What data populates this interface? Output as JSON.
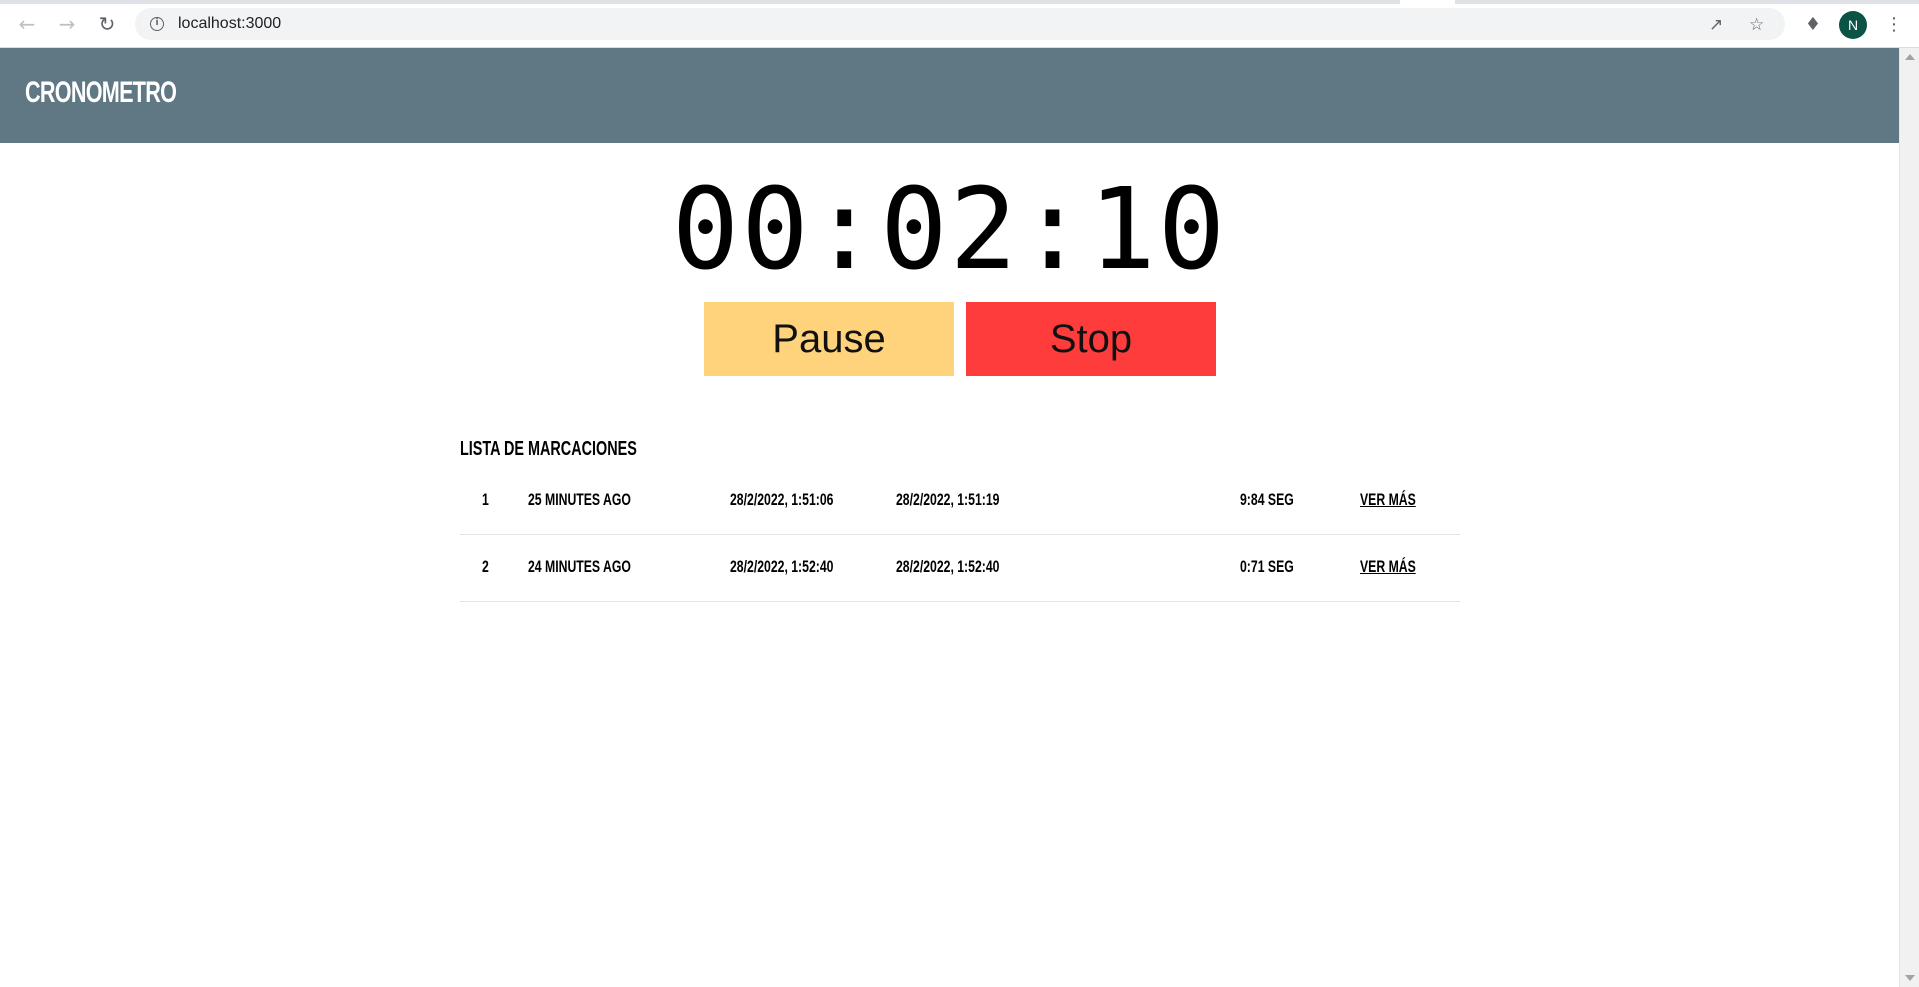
{
  "browser": {
    "url": "localhost:3000",
    "avatar_letter": "N",
    "icons": [
      "back-arrow-icon",
      "forward-arrow-icon",
      "reload-icon",
      "info-icon",
      "share-icon",
      "star-icon",
      "extensions-icon",
      "menu-icon"
    ]
  },
  "app": {
    "title": "CRONOMETRO",
    "header_color": "#607884"
  },
  "timer": {
    "display": "00:02:10"
  },
  "controls": {
    "pause_label": "Pause",
    "stop_label": "Stop",
    "pause_color": "#fed37b",
    "stop_color": "#ff3c3c"
  },
  "marks": {
    "title": "LISTA DE MARCACIONES",
    "rows": [
      {
        "index": "1",
        "ago": "25 MINUTES AGO",
        "start": "28/2/2022, 1:51:06",
        "end": "28/2/2022, 1:51:19",
        "duration": "9:84 SEG",
        "link": "VER MÁS"
      },
      {
        "index": "2",
        "ago": "24 MINUTES AGO",
        "start": "28/2/2022, 1:52:40",
        "end": "28/2/2022, 1:52:40",
        "duration": "0:71 SEG",
        "link": "VER MÁS"
      }
    ]
  }
}
